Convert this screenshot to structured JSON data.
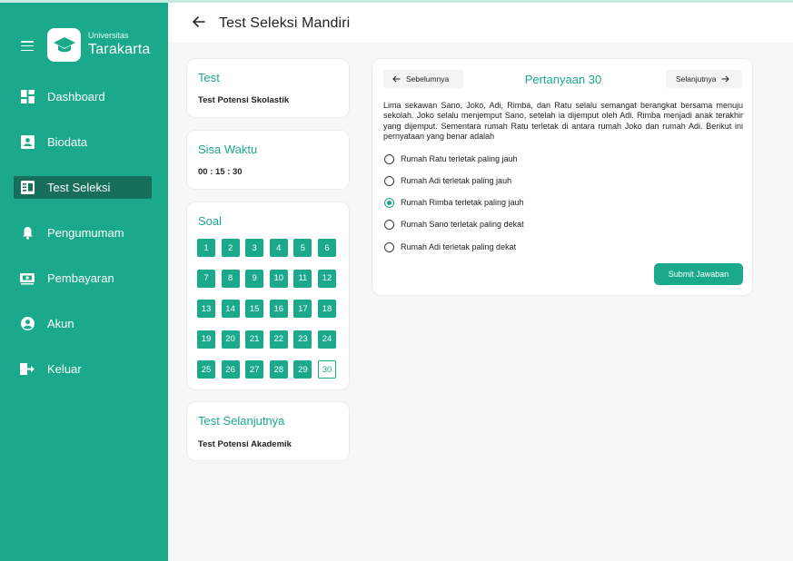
{
  "sidebar": {
    "logo_top": "Universitas",
    "logo_main": "Tarakarta",
    "items": [
      {
        "label": "Dashboard",
        "icon": "dashboard-icon"
      },
      {
        "label": "Biodata",
        "icon": "id-card-icon"
      },
      {
        "label": "Test Seleksi",
        "icon": "test-sheet-icon",
        "active": true
      },
      {
        "label": "Pengumumam",
        "icon": "bell-icon"
      },
      {
        "label": "Pembayaran",
        "icon": "payment-icon"
      },
      {
        "label": "Akun",
        "icon": "user-icon"
      },
      {
        "label": "Keluar",
        "icon": "logout-icon"
      }
    ]
  },
  "header": {
    "title": "Test Seleksi Mandiri"
  },
  "test_card": {
    "title": "Test",
    "value": "Test Potensi Skolastik"
  },
  "timer_card": {
    "title": "Sisa Waktu",
    "value": "00 : 15 : 30"
  },
  "soal_card": {
    "title": "Soal",
    "numbers": [
      "1",
      "2",
      "3",
      "4",
      "5",
      "6",
      "7",
      "8",
      "9",
      "10",
      "11",
      "12",
      "13",
      "14",
      "15",
      "16",
      "17",
      "18",
      "19",
      "20",
      "21",
      "22",
      "23",
      "24",
      "25",
      "26",
      "27",
      "28",
      "29",
      "30"
    ],
    "current": "30"
  },
  "next_test_card": {
    "title": "Test Selanjutnya",
    "value": "Test Potensi Akademik"
  },
  "question": {
    "prev_label": "Sebelumnya",
    "next_label": "Selanjutnya",
    "title": "Pertanyaan 30",
    "text": "Lima sekawan Sano, Joko, Adi, Rimba, dan Ratu selalu semangat berangkat bersama menuju sekolah. Joko selalu menjemput Sano, setelah ia dijemput oleh Adi. Rimba menjadi anak terakhir yang dijemput. Sementara rumah Ratu terletak di antara rumah Joko dan rumah Adi. Berikut ini pernyataan yang benar adalah",
    "options": [
      {
        "label": "Rumah Ratu terletak paling jauh",
        "selected": false
      },
      {
        "label": "Rumah Adi terletak paling jauh",
        "selected": false
      },
      {
        "label": "Rumah Rimba terletak paling jauh",
        "selected": true
      },
      {
        "label": "Rumah Sano terletak paling dekat",
        "selected": false
      },
      {
        "label": "Rumah Adi terletak paling dekat",
        "selected": false
      }
    ],
    "submit_label": "Submit Jawaban"
  },
  "colors": {
    "accent": "#1aa98a",
    "active_nav": "#176e5b",
    "background": "#f7f7f7"
  }
}
